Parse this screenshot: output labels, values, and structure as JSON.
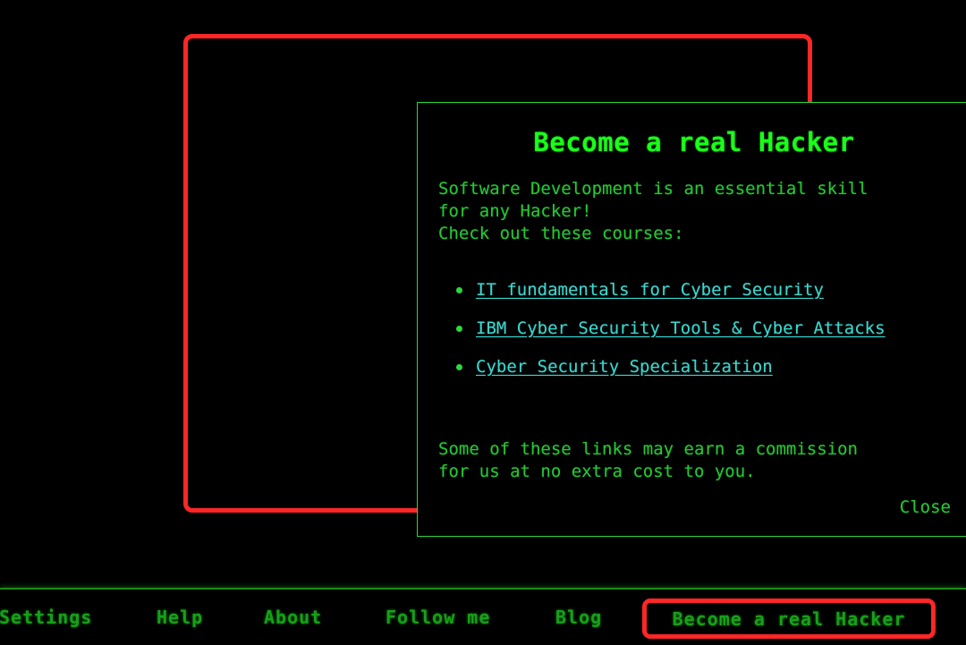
{
  "colors": {
    "background": "#000000",
    "highlight_border": "#ff2626",
    "panel_border": "#2bd93b",
    "title_green": "#1aff1a",
    "body_green": "#23c931",
    "link_cyan": "#3ad8d0",
    "nav_green": "#17a019"
  },
  "modal": {
    "title": "Become a real Hacker",
    "intro_line1": "Software Development is an essential skill",
    "intro_line2": "for any Hacker!",
    "intro_line3": "Check out these courses:",
    "courses": [
      {
        "label": "IT fundamentals for Cyber Security"
      },
      {
        "label": "IBM Cyber Security Tools & Cyber Attacks"
      },
      {
        "label": "Cyber Security Specialization"
      }
    ],
    "disclaimer_line1": "Some of these links may earn a commission",
    "disclaimer_line2": "for us at no extra cost to you.",
    "close_label": "Close"
  },
  "nav": {
    "items": [
      {
        "label": "Settings"
      },
      {
        "label": "Help"
      },
      {
        "label": "About"
      },
      {
        "label": "Follow me"
      },
      {
        "label": "Blog"
      },
      {
        "label": "Become a real Hacker",
        "highlighted": true
      }
    ]
  }
}
